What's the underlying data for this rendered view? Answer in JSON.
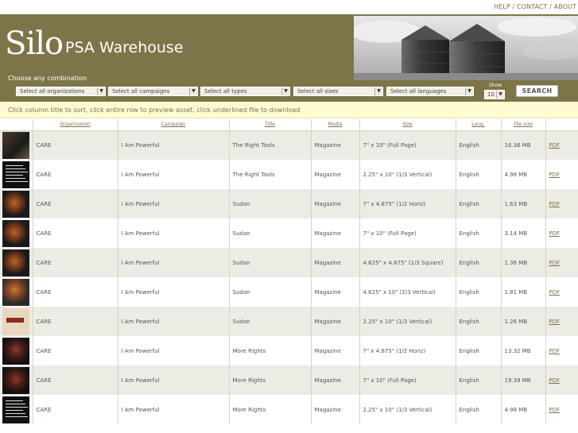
{
  "top_links": {
    "help": "HELP",
    "contact": "CONTACT",
    "about": "ABOUT",
    "sep": " / "
  },
  "header": {
    "logo": "Silo",
    "subtitle": "PSA Warehouse",
    "combo_label": "Choose any combination",
    "filters": [
      "Select all organizations",
      "Select all campaigns",
      "Select all types",
      "Select all sizes",
      "Select all languages"
    ],
    "show_label": "Show",
    "show_value": "10",
    "search_label": "SEARCH",
    "colors": {
      "header_bg": "#7d7548",
      "accent": "#7d7048",
      "instructions_bg": "#fdfbd3"
    }
  },
  "instructions": "Click column title to sort, click entire row to preview asset, click underlined file to download",
  "table": {
    "columns": [
      "",
      "Organization",
      "Campaign",
      "Title",
      "Media",
      "Size",
      "Lang.",
      "File size",
      ""
    ],
    "rows": [
      {
        "thumb": "dark-photo",
        "org": "CARE",
        "campaign": "I Am Powerful",
        "title": "The Right Tools",
        "media": "Magazine",
        "size": "7\" x 10\" (Full Page)",
        "lang": "English",
        "file_size": "16.36 MB",
        "file": "PDF"
      },
      {
        "thumb": "text-ad",
        "org": "CARE",
        "campaign": "I Am Powerful",
        "title": "The Right Tools",
        "media": "Magazine",
        "size": "2.25\" x 10\" (1/3 Vertical)",
        "lang": "English",
        "file_size": "4.98 MB",
        "file": "PDF"
      },
      {
        "thumb": "portrait",
        "org": "CARE",
        "campaign": "I Am Powerful",
        "title": "Sudan",
        "media": "Magazine",
        "size": "7\" x 4.875\" (1/2 Horiz)",
        "lang": "English",
        "file_size": "1.63 MB",
        "file": "PDF"
      },
      {
        "thumb": "portrait",
        "org": "CARE",
        "campaign": "I Am Powerful",
        "title": "Sudan",
        "media": "Magazine",
        "size": "7\" x 10\" (Full Page)",
        "lang": "English",
        "file_size": "3.14 MB",
        "file": "PDF"
      },
      {
        "thumb": "portrait",
        "org": "CARE",
        "campaign": "I Am Powerful",
        "title": "Sudan",
        "media": "Magazine",
        "size": "4.625\" x 4.875\" (1/3 Square)",
        "lang": "English",
        "file_size": "1.36 MB",
        "file": "PDF"
      },
      {
        "thumb": "portrait-light",
        "org": "CARE",
        "campaign": "I Am Powerful",
        "title": "Sudan",
        "media": "Magazine",
        "size": "4.625\" x 10\" (2/3 Vertical)",
        "lang": "English",
        "file_size": "1.81 MB",
        "file": "PDF"
      },
      {
        "thumb": "powerful",
        "org": "CARE",
        "campaign": "I Am Powerful",
        "title": "Sudan",
        "media": "Magazine",
        "size": "2.25\" x 10\" (1/3 Vertical)",
        "lang": "English",
        "file_size": "1.26 MB",
        "file": "PDF"
      },
      {
        "thumb": "dark-red",
        "org": "CARE",
        "campaign": "I Am Powerful",
        "title": "More Rights",
        "media": "Magazine",
        "size": "7\" x 4.875\" (1/2 Horiz)",
        "lang": "English",
        "file_size": "13.32 MB",
        "file": "PDF"
      },
      {
        "thumb": "dark-red",
        "org": "CARE",
        "campaign": "I Am Powerful",
        "title": "More Rights",
        "media": "Magazine",
        "size": "7\" x 10\" (Full Page)",
        "lang": "English",
        "file_size": "19.39 MB",
        "file": "PDF"
      },
      {
        "thumb": "text-ad",
        "org": "CARE",
        "campaign": "I Am Powerful",
        "title": "More Rights",
        "media": "Magazine",
        "size": "2.25\" x 10\" (1/3 Vertical)",
        "lang": "English",
        "file_size": "4.98 MB",
        "file": "PDF"
      }
    ]
  }
}
